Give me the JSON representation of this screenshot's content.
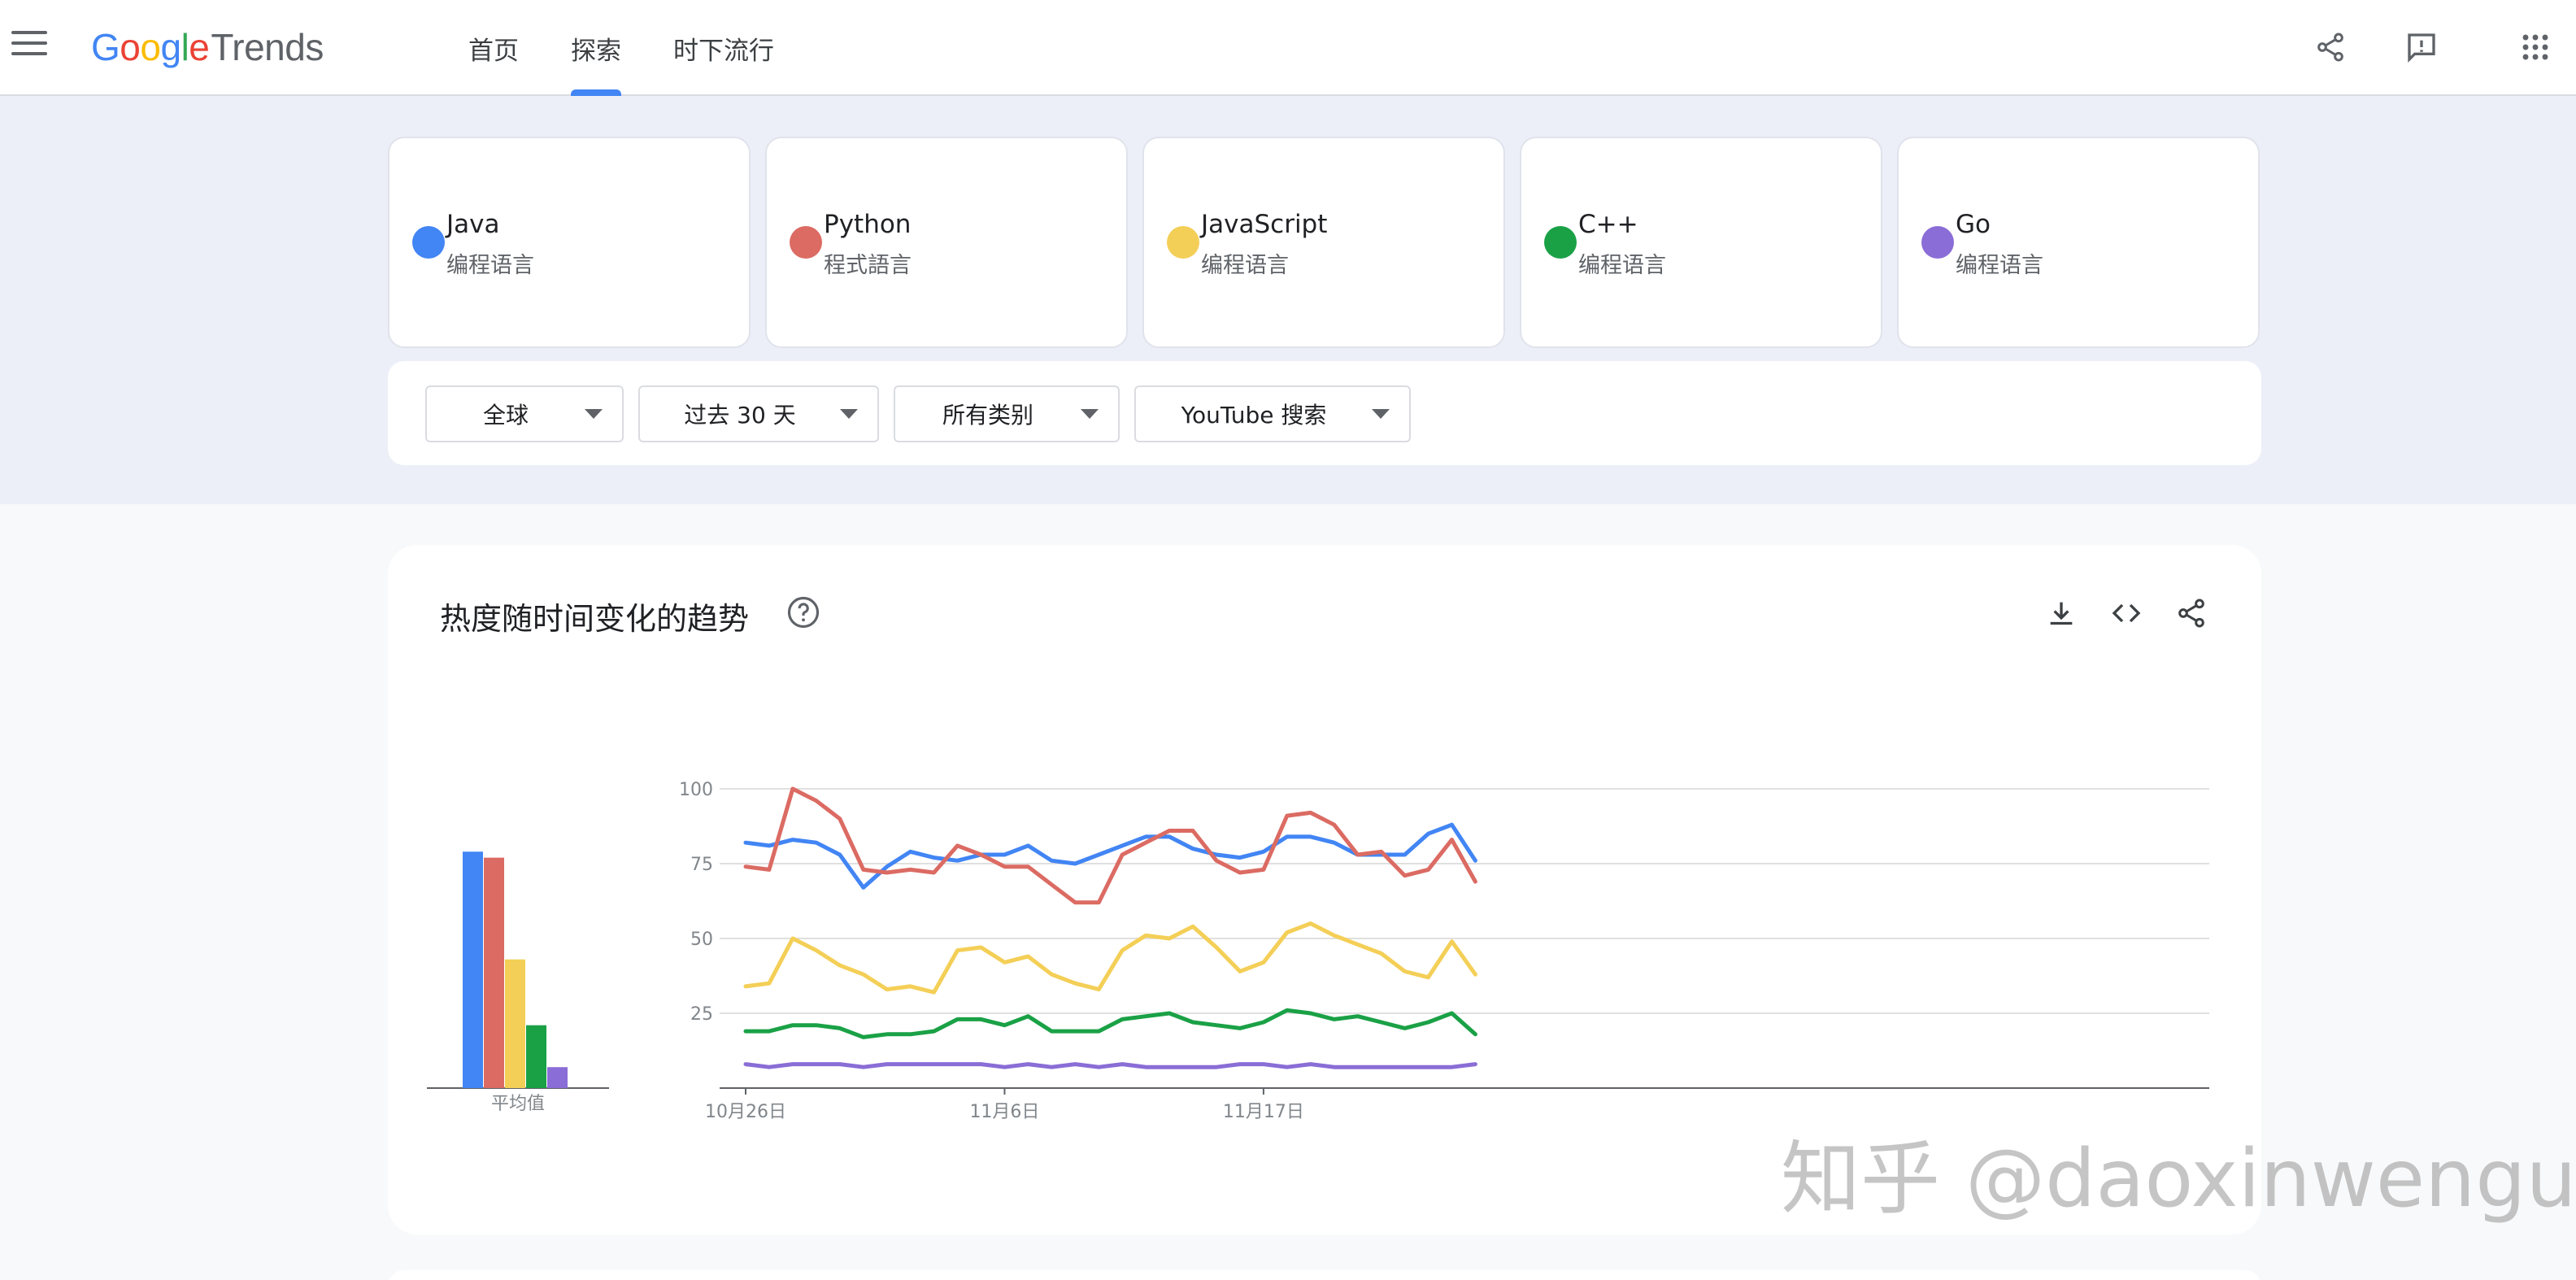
{
  "header": {
    "logo_google": "Google",
    "logo_trends": "Trends",
    "nav": [
      "首页",
      "探索",
      "时下流行"
    ],
    "active_nav_index": 1
  },
  "terms": [
    {
      "name": "Java",
      "category": "编程语言",
      "color": "#4285f4"
    },
    {
      "name": "Python",
      "category": "程式語言",
      "color": "#db6b63"
    },
    {
      "name": "JavaScript",
      "category": "编程语言",
      "color": "#f4cf57"
    },
    {
      "name": "C++",
      "category": "编程语言",
      "color": "#1aa146"
    },
    {
      "name": "Go",
      "category": "编程语言",
      "color": "#8a6dd6"
    }
  ],
  "filters": {
    "region": "全球",
    "time": "过去 30 天",
    "category": "所有类别",
    "source": "YouTube 搜索"
  },
  "card": {
    "title": "热度随时间变化的趋势"
  },
  "watermark": "知乎 @daoxinwengu",
  "chart_data": {
    "type": "line",
    "yticks": [
      "100",
      "75",
      "50",
      "25"
    ],
    "ylim": [
      0,
      100
    ],
    "x_labels": [
      "10月26日",
      "11月6日",
      "11月17日"
    ],
    "x_label_positions": [
      0,
      11,
      22
    ],
    "grid": true,
    "average_label": "平均值",
    "averages": [
      79,
      77,
      43,
      21,
      7
    ],
    "series": [
      {
        "name": "Java",
        "color": "#4285f4",
        "values": [
          82,
          81,
          83,
          82,
          78,
          67,
          74,
          79,
          77,
          76,
          78,
          78,
          81,
          76,
          75,
          78,
          81,
          84,
          84,
          80,
          78,
          77,
          79,
          84,
          84,
          82,
          78,
          78,
          78,
          85,
          88,
          76
        ]
      },
      {
        "name": "Python",
        "color": "#db6b63",
        "values": [
          74,
          73,
          100,
          96,
          90,
          73,
          72,
          73,
          72,
          81,
          78,
          74,
          74,
          68,
          62,
          62,
          78,
          82,
          86,
          86,
          76,
          72,
          73,
          91,
          92,
          88,
          78,
          79,
          71,
          73,
          83,
          69
        ]
      },
      {
        "name": "JavaScript",
        "color": "#f4cf57",
        "values": [
          34,
          35,
          50,
          46,
          41,
          38,
          33,
          34,
          32,
          46,
          47,
          42,
          44,
          38,
          35,
          33,
          46,
          51,
          50,
          54,
          47,
          39,
          42,
          52,
          55,
          51,
          48,
          45,
          39,
          37,
          49,
          38
        ]
      },
      {
        "name": "C++",
        "color": "#1aa146",
        "values": [
          19,
          19,
          21,
          21,
          20,
          17,
          18,
          18,
          19,
          23,
          23,
          21,
          24,
          19,
          19,
          19,
          23,
          24,
          25,
          22,
          21,
          20,
          22,
          26,
          25,
          23,
          24,
          22,
          20,
          22,
          25,
          18
        ]
      },
      {
        "name": "Go",
        "color": "#8a6dd6",
        "values": [
          8,
          7,
          8,
          8,
          8,
          7,
          8,
          8,
          8,
          8,
          8,
          7,
          8,
          7,
          8,
          7,
          8,
          7,
          7,
          7,
          7,
          8,
          8,
          7,
          8,
          7,
          7,
          7,
          7,
          7,
          7,
          8
        ]
      }
    ]
  }
}
